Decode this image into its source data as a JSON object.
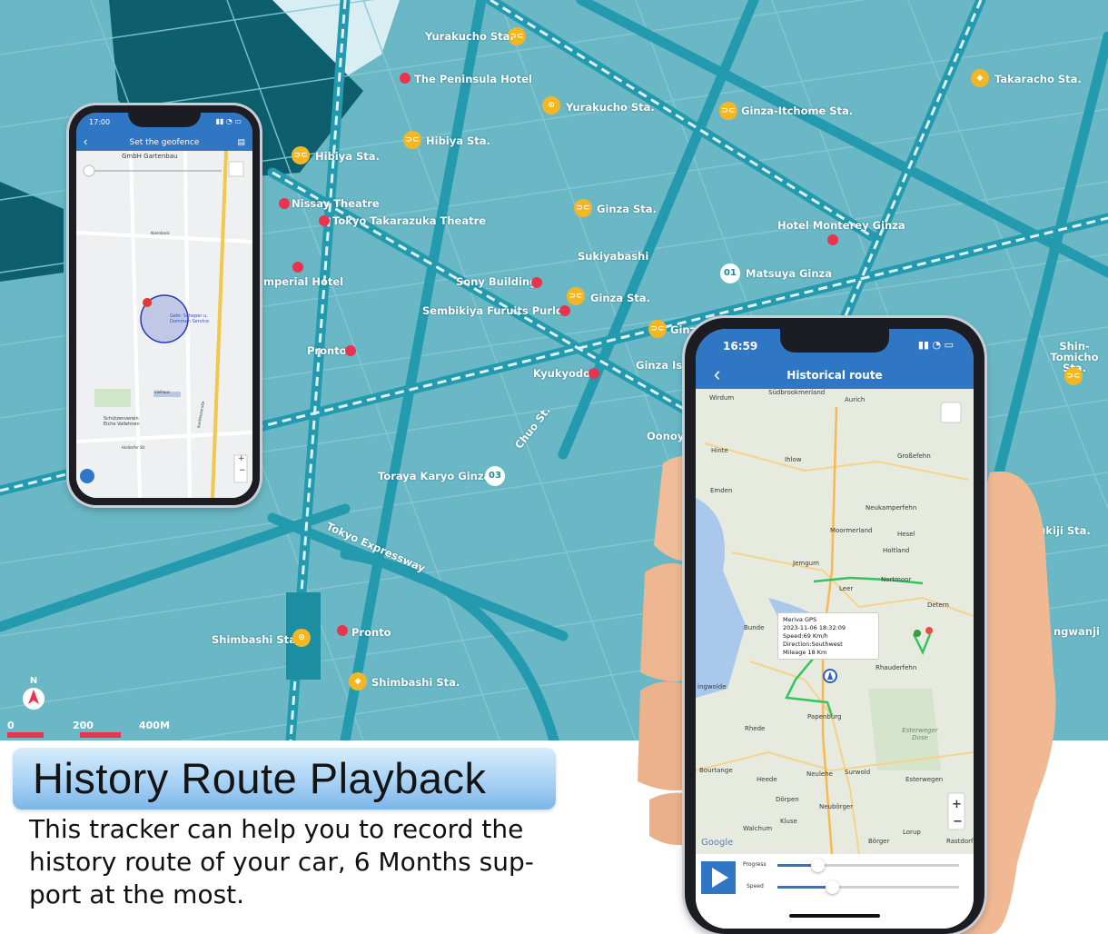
{
  "background_map": {
    "stations": [
      "Yurakucho Sta.",
      "Yurakucho Sta.",
      "Ginza-Itchome Sta.",
      "Takaracho Sta.",
      "Hibiya Sta.",
      "Hibiya Sta.",
      "Ginza Sta.",
      "Ginza Sta.",
      "Ginz",
      "Shin-Tomicho Sta.",
      "Tsukiji Sta.",
      "Shimbashi Sta.",
      "Shimbashi Sta."
    ],
    "places": [
      "The Peninsula Hotel",
      "Nissay Theatre",
      "Tokyo Takarazuka Theatre",
      "Hotel Monterey Ginza",
      "Sukiyabashi",
      "Matsuya Ginza",
      "mperial Hotel",
      "Sony Building",
      "Sembikiya Furuits Purlor",
      "Pronto",
      "Kyukyodo",
      "Ginza Iso",
      "Oonoya",
      "Toraya Karyo Ginza",
      "Chuo St.",
      "Tokyo Expressway",
      "Pronto",
      "ngwanji"
    ],
    "badges": [
      "01",
      "03"
    ],
    "compass": "N",
    "scale": [
      "0",
      "200",
      "400M"
    ]
  },
  "phone_geofence": {
    "time": "17:00",
    "title": "Set the geofence",
    "map_labels": [
      "GmbH Gartenbau",
      "Gebr. Scheper u. Dommen Service",
      "Schützenverein Eiche Vallehnen",
      "Vielhaus",
      "Kolenbank",
      "Stettfeldstraße",
      "Holdorfer Str."
    ],
    "zoom": [
      "+",
      "−"
    ]
  },
  "phone_history": {
    "time": "16:59",
    "title": "Historical route",
    "map_labels": [
      "Wirdum",
      "Südbrookmerland",
      "Aurich",
      "Hinte",
      "Ihlow",
      "Großefehn",
      "Emden",
      "Neukamperfehn",
      "Moormerland",
      "Hesel",
      "Holtland",
      "Jemgum",
      "Nortmoor",
      "Leer",
      "Detern",
      "Bunde",
      "Rhauderfehn",
      "Weener",
      "ingwolde",
      "Papenburg",
      "Rhede",
      "Esterweger Dose",
      "Bourtange",
      "Heede",
      "Neulehe",
      "Surwold",
      "Esterwegen",
      "Dörpen",
      "Neubörger",
      "Kluse",
      "Walchum",
      "Börger",
      "Lorup",
      "Rastdorf",
      "Google"
    ],
    "popup": {
      "device": "Meriva  GPS",
      "datetime": "2023-11-06 18:32:09",
      "speed": "Speed:69 Km/h",
      "direction": "Direction:Southwest",
      "mileage": "Mileage 18 Km"
    },
    "controls": {
      "progress_label": "Progress",
      "speed_label": "Speed",
      "progress_value": 0.22,
      "speed_value": 0.3
    },
    "zoom": [
      "+",
      "−"
    ]
  },
  "headline": "History Route Playback",
  "description": "This tracker can help you to record the\nhistory route of your car, 6 Months sup-\nport at the most.",
  "colors": {
    "map_bg": "#67b5c3",
    "road": "#2a9caf",
    "accent": "#2f76c5",
    "poi": "#e8344f",
    "station": "#f2b723"
  }
}
